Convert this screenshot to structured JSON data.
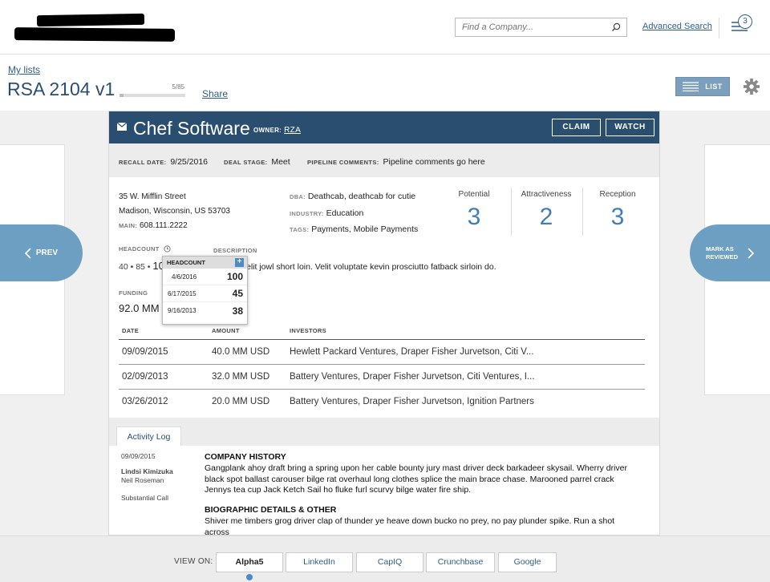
{
  "topbar": {
    "search_placeholder": "Find a Company...",
    "advanced_search": "Advanced Search",
    "notification_count": "3"
  },
  "list": {
    "breadcrumb": "My lists",
    "title": "RSA 2104 v1",
    "progress_text": "5/85",
    "progress_fraction": 0.0588,
    "share": "Share",
    "list_button": "LIST"
  },
  "nav": {
    "prev": "PREV",
    "next_line1": "MARK AS",
    "next_line2": "REVIEWED"
  },
  "company": {
    "name": "Chef Software",
    "owner_label": "OWNER:",
    "owner": "RZA",
    "claim": "CLAIM",
    "watch": "WATCH",
    "recall_label": "RECALL DATE:",
    "recall_value": "9/25/2016",
    "deal_label": "DEAL STAGE:",
    "deal_value": "Meet",
    "pipeline_label": "PIPELINE COMMENTS:",
    "pipeline_value": "Pipeline comments go here",
    "address1": "35 W. Mifflin Street",
    "address2": "Madison, Wisconsin, US 53703",
    "main_label": "MAIN:",
    "main_value": "608.111.2222",
    "dba_label": "DBA:",
    "dba_value": "Deathcab, deathcab for cutie",
    "industry_label": "INDUSTRY:",
    "industry_value": "Education",
    "tags_label": "TAGS:",
    "tags_value": "Payments, Mobile Payments",
    "scores": [
      {
        "label": "Potential",
        "value": "3"
      },
      {
        "label": "Attractiveness",
        "value": "2"
      },
      {
        "label": "Reception",
        "value": "3"
      }
    ],
    "headcount_label": "HEADCOUNT",
    "headcount_prefix": "40 • 85 •",
    "headcount_latest": "10",
    "description_label": "DESCRIPTION",
    "description": "elit jowl short loin. Velit voluptate kevin prosciutto fatback sirloin do.",
    "funding_label": "FUNDING",
    "funding_value": "92.0 MM"
  },
  "headcount_popup": {
    "title": "HEADCOUNT",
    "rows": [
      {
        "date": "4/6/2016",
        "value": "100"
      },
      {
        "date": "6/17/2015",
        "value": "45"
      },
      {
        "date": "9/16/2013",
        "value": "38"
      }
    ]
  },
  "funding_table": {
    "headers": [
      "DATE",
      "AMOUNT",
      "INVESTORS"
    ],
    "rows": [
      {
        "date": "09/09/2015",
        "amount": "40.0 MM USD",
        "investors": "Hewlett Packard Ventures, Draper Fisher Jurvetson, Citi V..."
      },
      {
        "date": "02/09/2013",
        "amount": "32.0 MM USD",
        "investors": "Battery Ventures, Draper Fisher Jurvetson, Citi Ventures, I..."
      },
      {
        "date": "03/26/2012",
        "amount": "20.0 MM USD",
        "investors": "Battery Ventures, Draper Fisher Jurvetson, Ignition Partners"
      }
    ]
  },
  "activity": {
    "tab": "Activity Log",
    "date": "09/09/2015",
    "author1": "Lindsi Kimizuka",
    "author2": "Neil Roseman",
    "type": "Substantial Call",
    "sec1_title": "COMPANY HISTORY",
    "sec1_line1": "Gangplank ahoy draft bring a spring upon her cable bounty jury mast driver deck barkadeer skysail. Wherry driver",
    "sec1_line2": "black spot ballast carouser bilge rat overhaul long clothes splice the main brace chase. Marooned parrel crack",
    "sec1_line3": "Jennys tea cup Jack Ketch Sail ho fluke furl scurvy bilge water fire ship.",
    "sec2_title": "BIOGRAPHIC DETAILS & OTHER",
    "sec2_line1": "Shiver me timbers grog driver clap of thunder ye heave down bucko no prey, no pay plunder spike. Run a shot across"
  },
  "view_on": {
    "label": "VIEW ON:",
    "buttons": [
      "Alpha5",
      "LinkedIn",
      "CapIQ",
      "Crunchbase",
      "Google"
    ]
  },
  "colors": {
    "header_navy": "#2a4e6f",
    "accent_blue": "#3f7fb5",
    "nav_blue": "#6d9fc3"
  }
}
